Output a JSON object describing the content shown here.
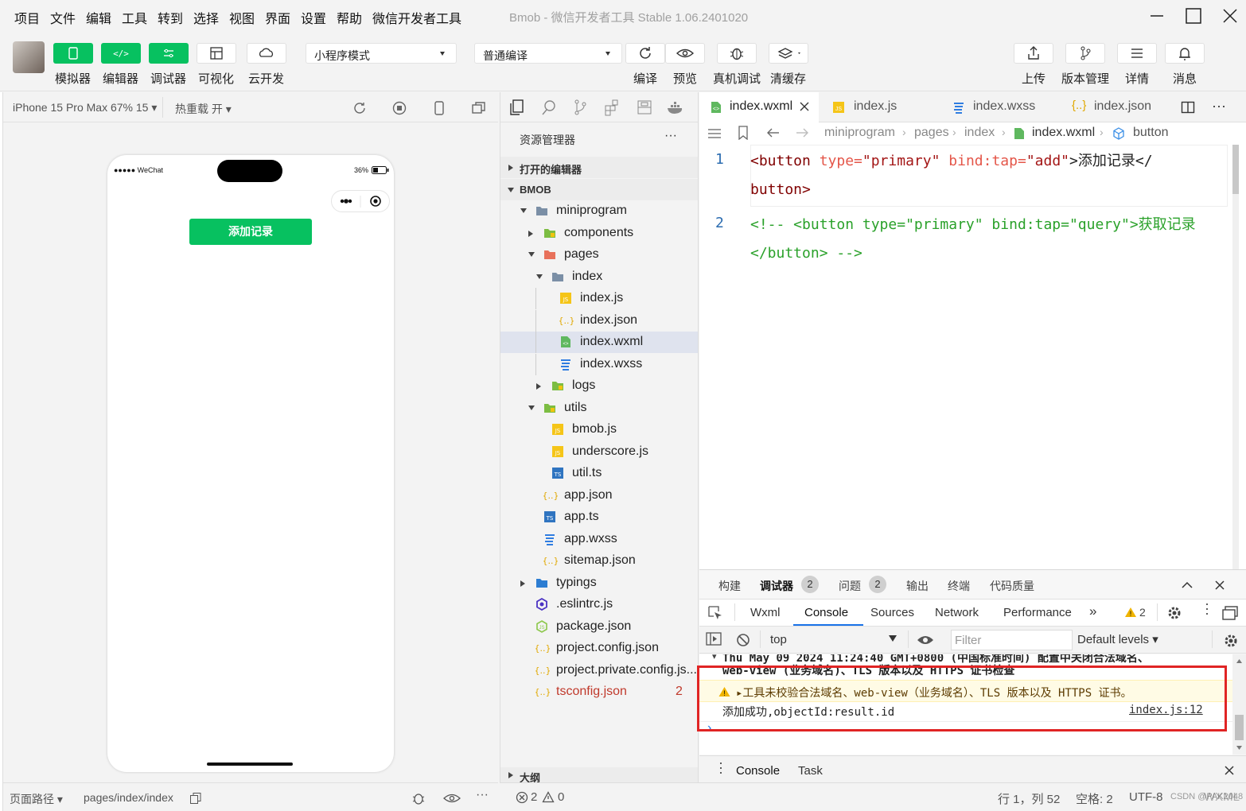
{
  "menu": [
    "项目",
    "文件",
    "编辑",
    "工具",
    "转到",
    "选择",
    "视图",
    "界面",
    "设置",
    "帮助",
    "微信开发者工具"
  ],
  "window_title": "Bmob - 微信开发者工具 Stable 1.06.2401020",
  "toolbar": {
    "left_buttons": [
      "模拟器",
      "编辑器",
      "调试器",
      "可视化",
      "云开发"
    ],
    "mode_select": "小程序模式",
    "compile_select": "普通编译",
    "mid_buttons": [
      "编译",
      "预览",
      "真机调试",
      "清缓存"
    ],
    "right_buttons": [
      "上传",
      "版本管理",
      "详情",
      "消息"
    ]
  },
  "simulator": {
    "device": "iPhone 15 Pro Max 67% 15 ▾",
    "hot_reload": "热重载 开 ▾",
    "status_left": "●●●●● WeChat",
    "battery": "36%",
    "add_button": "添加记录",
    "page_path_label": "页面路径 ▾",
    "page_path": "pages/index/index"
  },
  "explorer": {
    "title": "资源管理器",
    "more": "···",
    "open_editors": "打开的编辑器",
    "project": "BMOB",
    "tree": [
      {
        "label": "miniprogram",
        "icon": "folder-icon"
      },
      {
        "label": "components",
        "icon": "folder-icon"
      },
      {
        "label": "pages",
        "icon": "folder-icon"
      },
      {
        "label": "index",
        "icon": "folder-icon"
      },
      {
        "label": "index.js",
        "icon": "js-file-icon"
      },
      {
        "label": "index.json",
        "icon": "json-file-icon"
      },
      {
        "label": "index.wxml",
        "icon": "wxml-file-icon"
      },
      {
        "label": "index.wxss",
        "icon": "wxss-file-icon"
      },
      {
        "label": "logs",
        "icon": "folder-icon"
      },
      {
        "label": "utils",
        "icon": "folder-icon"
      },
      {
        "label": "bmob.js",
        "icon": "js-file-icon"
      },
      {
        "label": "underscore.js",
        "icon": "js-file-icon"
      },
      {
        "label": "util.ts",
        "icon": "ts-file-icon"
      },
      {
        "label": "app.json",
        "icon": "json-file-icon"
      },
      {
        "label": "app.ts",
        "icon": "ts-file-icon"
      },
      {
        "label": "app.wxss",
        "icon": "wxss-file-icon"
      },
      {
        "label": "sitemap.json",
        "icon": "json-file-icon"
      },
      {
        "label": "typings",
        "icon": "folder-icon"
      },
      {
        "label": ".eslintrc.js",
        "icon": "eslint-file-icon"
      },
      {
        "label": "package.json",
        "icon": "npm-file-icon"
      },
      {
        "label": "project.config.json",
        "icon": "json-file-icon"
      },
      {
        "label": "project.private.config.js...",
        "icon": "json-file-icon"
      },
      {
        "label": "tsconfig.json",
        "icon": "json-file-icon",
        "badge": "2"
      }
    ],
    "outline": "大纲"
  },
  "editor": {
    "tabs": [
      "index.wxml",
      "index.js",
      "index.wxss",
      "index.json"
    ],
    "breadcrumb": [
      "miniprogram",
      "pages",
      "index",
      "index.wxml",
      "button"
    ],
    "line_numbers": [
      "1",
      "2"
    ],
    "code": {
      "l1a_tag": "<button",
      "l1a_attr1": "type=",
      "l1a_val1": "\"primary\"",
      "l1a_attr2": "bind:tap=",
      "l1a_val2": "\"add\"",
      "l1a_text": ">添加记录</",
      "l1b": "button>",
      "l2a": "<!-- <button type=\"primary\" bind:tap=\"query\">获取记录",
      "l2b": "</button> -->"
    }
  },
  "debug": {
    "tabs": [
      "构建",
      "调试器",
      "问题",
      "输出",
      "终端",
      "代码质量"
    ],
    "debugger_badge": "2",
    "problems_badge": "2",
    "devtools_tabs": [
      "Wxml",
      "Console",
      "Sources",
      "Network",
      "Performance",
      "»"
    ],
    "warn_count": "2",
    "context": "top",
    "filter_placeholder": "Filter",
    "levels": "Default levels ▾",
    "lines": {
      "trunc1": "Thu May 09 2024 11:24:40 GMT+0800 (中国标准时间) 配置中关闭合法域名、",
      "trunc2": "web-view (业务域名)、TLS 版本以及 HTTPS 证书检查",
      "warn": "▸工具未校验合法域名、web-view（业务域名）、TLS 版本以及 HTTPS 证书。",
      "log": "添加成功,objectId:result.id",
      "log_src": "index.js:12",
      "prompt": "›"
    },
    "drawer_tabs": [
      "Console",
      "Task"
    ]
  },
  "status": {
    "errors": "2",
    "warnings": "0",
    "position": "行 1，列 52",
    "spaces": "空格: 2",
    "encoding": "UTF-8",
    "lang": "WXML",
    "watermark": "CSDN @PAK2048"
  },
  "colors": {
    "green": "#07c160",
    "tag": "#800000",
    "attr": "#e45649",
    "string": "#a31515",
    "comment": "#2aa12a"
  }
}
